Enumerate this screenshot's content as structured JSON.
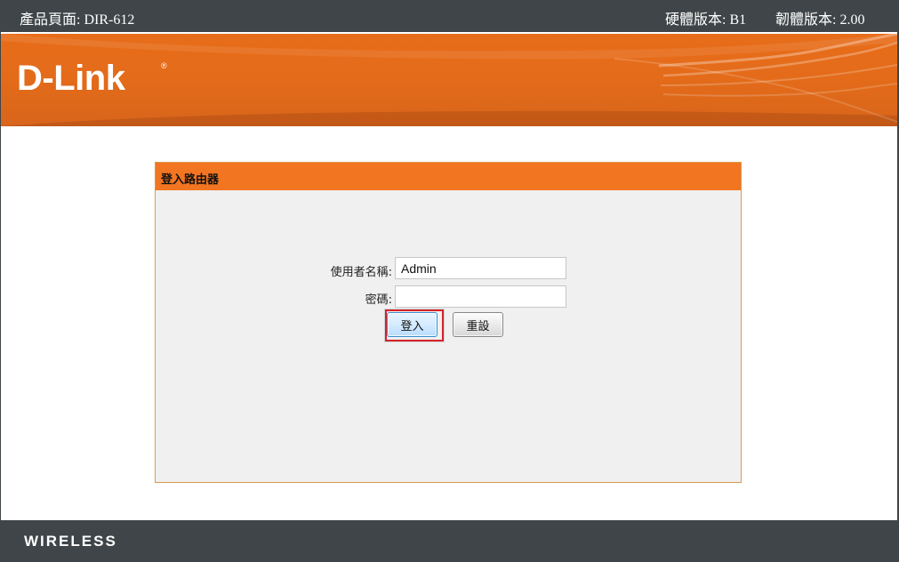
{
  "header": {
    "product_page": "產品頁面: DIR-612",
    "hardware_version": "硬體版本: B1",
    "firmware_version": "韌體版本: 2.00"
  },
  "branding": {
    "logo_text": "D-Link",
    "registered_mark": "®"
  },
  "login": {
    "title": "登入路由器",
    "username_label": "使用者名稱:",
    "username_value": "Admin",
    "password_label": "密碼:",
    "password_value": "",
    "login_button": "登入",
    "reset_button": "重設"
  },
  "footer": {
    "label": "WIRELESS"
  },
  "colors": {
    "top_bar": "#3f4548",
    "banner_orange": "#e36b19",
    "panel_header": "#f27521",
    "panel_background": "#f0f0f0",
    "focus_outline": "#d6232a",
    "login_button_border": "#3c8ccf"
  }
}
